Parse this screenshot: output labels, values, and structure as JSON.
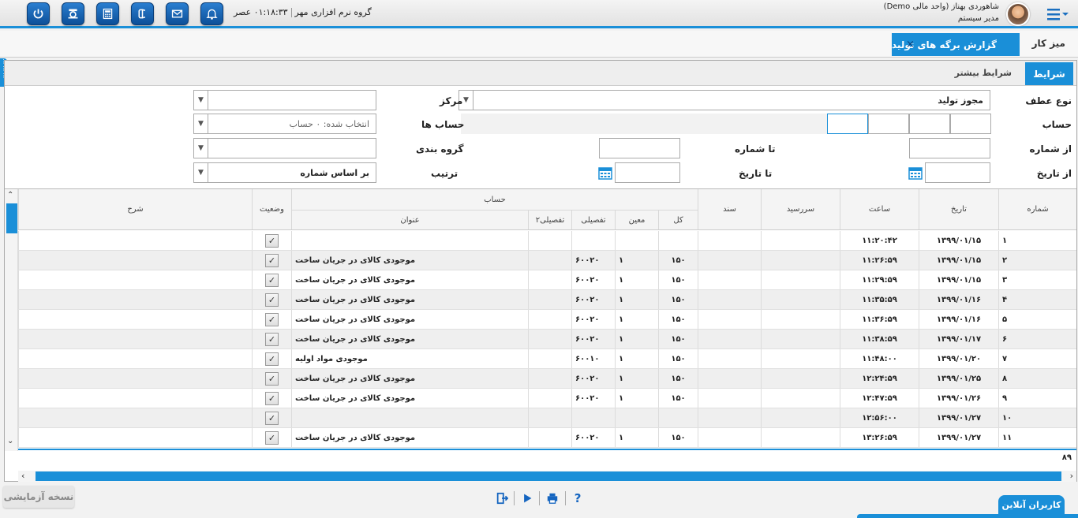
{
  "header": {
    "company": "گروه نرم افزاری مهر",
    "clock": "۰۱:۱۸:۳۳ عصر",
    "user_name": "شاهوردی بهناز (واحد مالی Demo)",
    "user_role": "مدیر سیستم",
    "icons": [
      "power-icon",
      "settings-icon",
      "calculator-icon",
      "phone-icon",
      "mail-icon",
      "bell-icon"
    ]
  },
  "tabs": {
    "home": "میز کار",
    "active": "گزارش برگه های تولید",
    "close": "×"
  },
  "subtabs": {
    "conditions": "شرایط",
    "more": "شرایط بیشتر"
  },
  "form": {
    "ref_type_label": "نوع عطف",
    "ref_type_value": "مجوز تولید",
    "center_label": "مرکز",
    "center_value": "",
    "account_label": "حساب",
    "accounts_label": "حساب ها",
    "accounts_value": "انتخاب شده: ۰ حساب",
    "from_number_label": "از شماره",
    "to_number_label": "تا شماره",
    "grouping_label": "گروه بندی",
    "from_date_label": "از تاریخ",
    "to_date_label": "تا تاریخ",
    "sort_label": "ترتیب",
    "sort_value": "بر اساس شماره"
  },
  "grid": {
    "headers": {
      "number": "شماره",
      "date": "تاریخ",
      "time": "ساعت",
      "due": "سررسید",
      "doc": "سند",
      "account_group": "حساب",
      "kol": "کل",
      "moin": "معین",
      "tafsili": "تفصیلی",
      "tafsili2": "تفصیلی۲",
      "title": "عنوان",
      "status": "وضعیت",
      "desc": "شرح"
    },
    "rows": [
      {
        "n": "۱",
        "date": "۱۳۹۹/۰۱/۱۵",
        "time": "۱۱:۲۰:۴۲",
        "kol": "",
        "moin": "",
        "taf": "",
        "title": ""
      },
      {
        "n": "۲",
        "date": "۱۳۹۹/۰۱/۱۵",
        "time": "۱۱:۲۶:۵۹",
        "kol": "۱۵۰",
        "moin": "۱",
        "taf": "۶۰۰۲۰",
        "title": "موجودی کالای در جریان ساخت"
      },
      {
        "n": "۳",
        "date": "۱۳۹۹/۰۱/۱۵",
        "time": "۱۱:۲۹:۵۹",
        "kol": "۱۵۰",
        "moin": "۱",
        "taf": "۶۰۰۲۰",
        "title": "موجودی کالای در جریان ساخت"
      },
      {
        "n": "۴",
        "date": "۱۳۹۹/۰۱/۱۶",
        "time": "۱۱:۳۵:۵۹",
        "kol": "۱۵۰",
        "moin": "۱",
        "taf": "۶۰۰۲۰",
        "title": "موجودی کالای در جریان ساخت"
      },
      {
        "n": "۵",
        "date": "۱۳۹۹/۰۱/۱۶",
        "time": "۱۱:۳۶:۵۹",
        "kol": "۱۵۰",
        "moin": "۱",
        "taf": "۶۰۰۲۰",
        "title": "موجودی کالای در جریان ساخت"
      },
      {
        "n": "۶",
        "date": "۱۳۹۹/۰۱/۱۷",
        "time": "۱۱:۳۸:۵۹",
        "kol": "۱۵۰",
        "moin": "۱",
        "taf": "۶۰۰۲۰",
        "title": "موجودی کالای در جریان ساخت"
      },
      {
        "n": "۷",
        "date": "۱۳۹۹/۰۱/۲۰",
        "time": "۱۱:۴۸:۰۰",
        "kol": "۱۵۰",
        "moin": "۱",
        "taf": "۶۰۰۱۰",
        "title": "موجودی مواد اولیه"
      },
      {
        "n": "۸",
        "date": "۱۳۹۹/۰۱/۲۵",
        "time": "۱۲:۲۴:۵۹",
        "kol": "۱۵۰",
        "moin": "۱",
        "taf": "۶۰۰۲۰",
        "title": "موجودی کالای در جریان ساخت"
      },
      {
        "n": "۹",
        "date": "۱۳۹۹/۰۱/۲۶",
        "time": "۱۲:۴۷:۵۹",
        "kol": "۱۵۰",
        "moin": "۱",
        "taf": "۶۰۰۲۰",
        "title": "موجودی کالای در جریان ساخت"
      },
      {
        "n": "۱۰",
        "date": "۱۳۹۹/۰۱/۲۷",
        "time": "۱۲:۵۶:۰۰",
        "kol": "",
        "moin": "",
        "taf": "",
        "title": ""
      },
      {
        "n": "۱۱",
        "date": "۱۳۹۹/۰۱/۲۷",
        "time": "۱۳:۲۶:۵۹",
        "kol": "۱۵۰",
        "moin": "۱",
        "taf": "۶۰۰۲۰",
        "title": "موجودی کالای در جریان ساخت"
      }
    ],
    "check": "✓",
    "total_count": "۸۹"
  },
  "footer": {
    "trial": "نسخه آزمایشی",
    "online_users": "کاربران آنلاین",
    "help": "?"
  },
  "colors": {
    "accent": "#1a8fd8",
    "icon_bg": "#0c4f98"
  }
}
